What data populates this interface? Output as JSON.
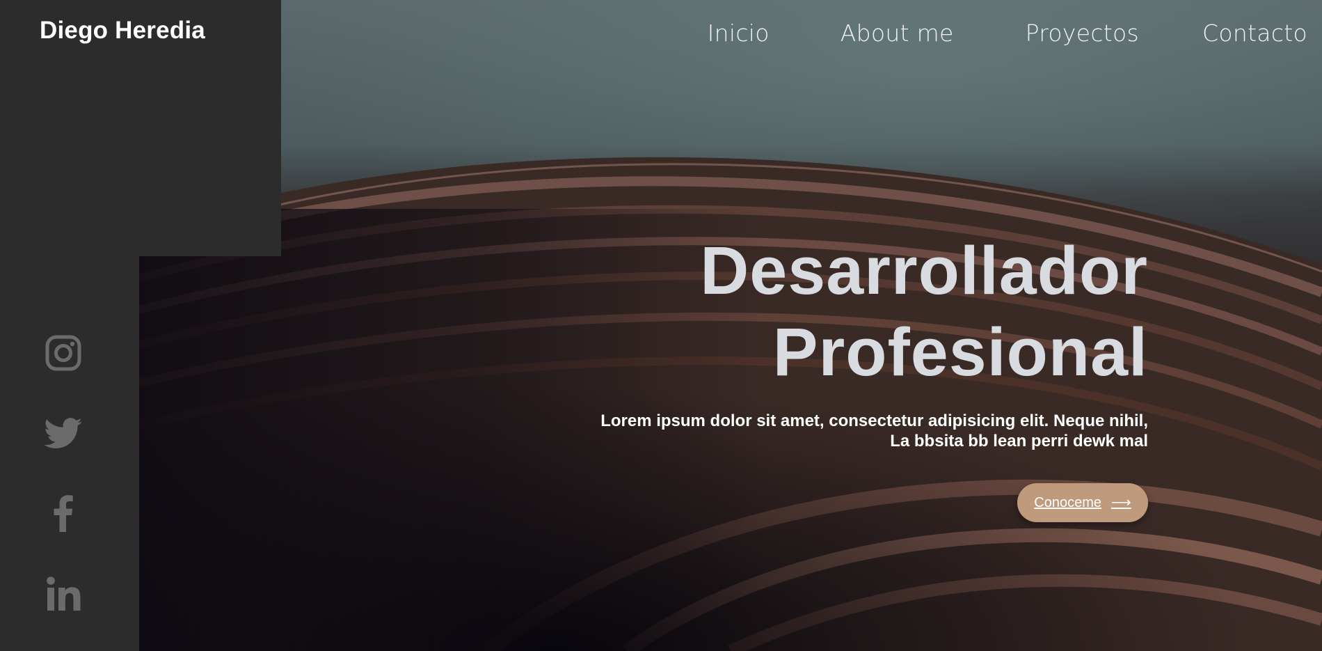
{
  "brand": {
    "name": "Diego Heredia"
  },
  "nav": {
    "items": [
      {
        "label": "Inicio"
      },
      {
        "label": "About me"
      },
      {
        "label": "Proyectos"
      },
      {
        "label": "Contacto"
      }
    ]
  },
  "hero": {
    "title_line1": "Desarrollador",
    "title_line2": "Profesional",
    "subtitle_line1": "Lorem ipsum dolor sit amet, consectetur adipisicing elit. Neque nihil,",
    "subtitle_line2": "La bbsita bb lean perri dewk mal",
    "cta_label": "Conoceme",
    "cta_icon": "arrow-right-icon"
  },
  "social": {
    "icons": [
      "instagram-icon",
      "twitter-icon",
      "facebook-icon",
      "linkedin-icon"
    ]
  },
  "colors": {
    "sidebar": "#2c2c2c",
    "title": "#d8dbe0",
    "cta": "#c09a7c",
    "icon": "#6b6b6b"
  }
}
